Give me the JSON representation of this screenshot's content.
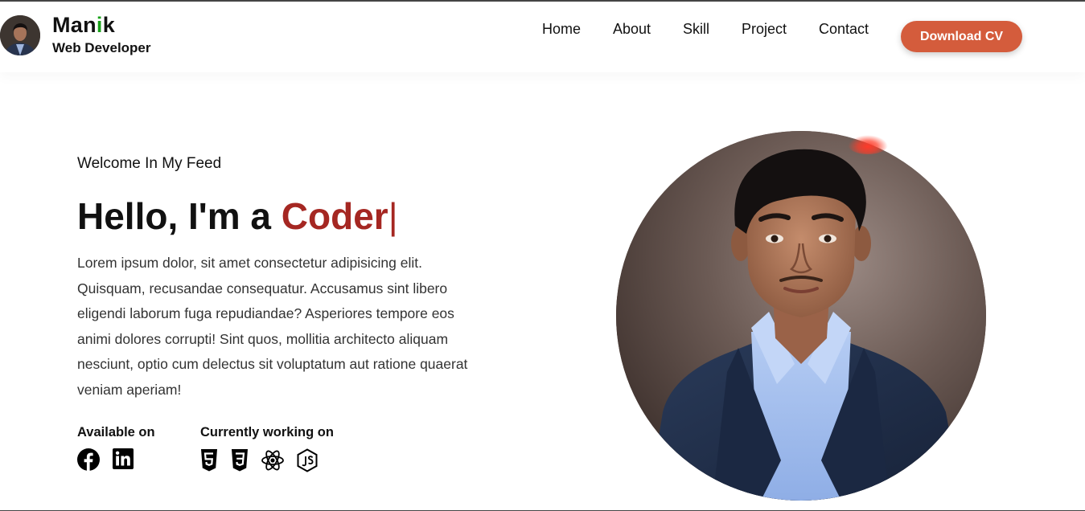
{
  "header": {
    "brand": {
      "name_prefix": "Man",
      "name_accent": "i",
      "name_suffix": "k",
      "role": "Web Developer"
    },
    "nav": [
      {
        "label": "Home"
      },
      {
        "label": "About"
      },
      {
        "label": "Skill"
      },
      {
        "label": "Project"
      },
      {
        "label": "Contact"
      }
    ],
    "cta_label": "Download CV"
  },
  "hero": {
    "welcome": "Welcome In My Feed",
    "greeting": "Hello, I'm a ",
    "role_word": "Coder",
    "cursor": "|",
    "intro": "Lorem ipsum dolor, sit amet consectetur adipisicing elit. Quisquam, recusandae consequatur. Accusamus sint libero eligendi laborum fuga repudiandae? Asperiores tempore eos animi dolores corrupti! Sint quos, mollitia architecto aliquam nesciunt, optio cum delectus sit voluptatum aut ratione quaerat veniam aperiam!",
    "available_title": "Available on",
    "available_icons": [
      "facebook-icon",
      "linkedin-icon"
    ],
    "working_title": "Currently working on",
    "working_icons": [
      "html5-icon",
      "css3-icon",
      "react-icon",
      "nodejs-icon"
    ]
  },
  "colors": {
    "brand_accent": "#19a119",
    "role_word": "#a52722",
    "cta_background": "#d45c3c"
  }
}
